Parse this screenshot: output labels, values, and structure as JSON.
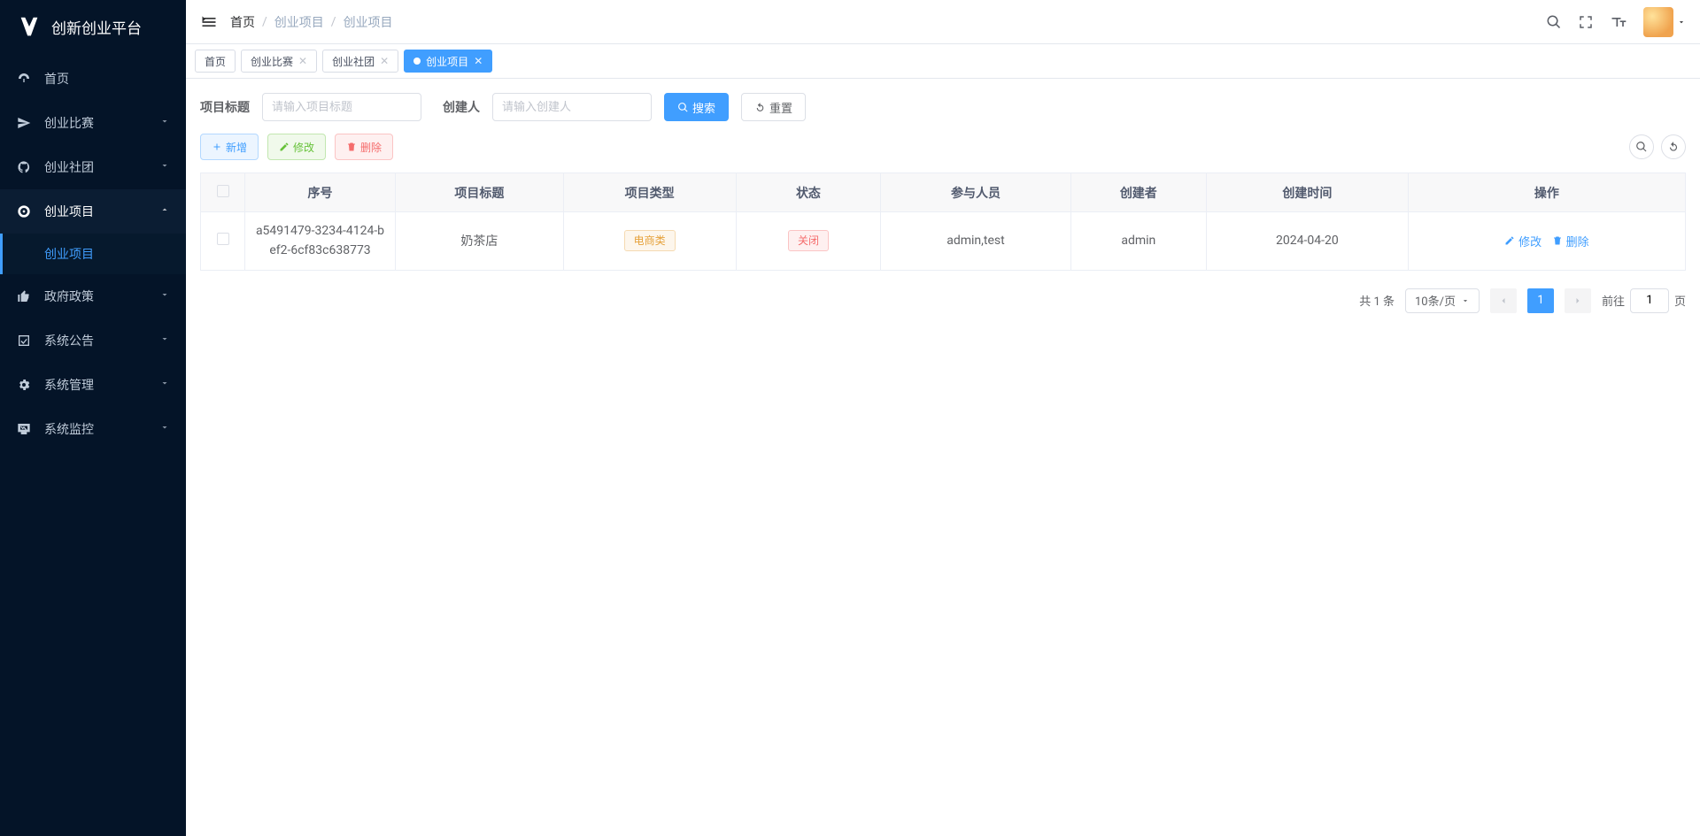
{
  "brand": "创新创业平台",
  "sidebar": {
    "items": [
      {
        "label": "首页",
        "has_children": false
      },
      {
        "label": "创业比赛",
        "has_children": true
      },
      {
        "label": "创业社团",
        "has_children": true
      },
      {
        "label": "创业项目",
        "has_children": true,
        "open": true,
        "children": [
          {
            "label": "创业项目",
            "active": true
          }
        ]
      },
      {
        "label": "政府政策",
        "has_children": true
      },
      {
        "label": "系统公告",
        "has_children": true
      },
      {
        "label": "系统管理",
        "has_children": true
      },
      {
        "label": "系统监控",
        "has_children": true
      }
    ]
  },
  "breadcrumb": [
    "首页",
    "创业项目",
    "创业项目"
  ],
  "tabs": [
    {
      "label": "首页",
      "closable": false,
      "active": false
    },
    {
      "label": "创业比赛",
      "closable": true,
      "active": false
    },
    {
      "label": "创业社团",
      "closable": true,
      "active": false
    },
    {
      "label": "创业项目",
      "closable": true,
      "active": true
    }
  ],
  "filters": {
    "title_label": "项目标题",
    "title_placeholder": "请输入项目标题",
    "creator_label": "创建人",
    "creator_placeholder": "请输入创建人"
  },
  "buttons": {
    "search": "搜索",
    "reset": "重置",
    "add": "新增",
    "edit": "修改",
    "delete": "删除"
  },
  "table": {
    "cols": [
      "序号",
      "项目标题",
      "项目类型",
      "状态",
      "参与人员",
      "创建者",
      "创建时间",
      "操作"
    ],
    "rows": [
      {
        "seq": "a5491479-3234-4124-bef2-6cf83c638773",
        "title": "奶茶店",
        "type": "电商类",
        "status": "关闭",
        "participants": "admin,test",
        "creator": "admin",
        "created_at": "2024-04-20"
      }
    ]
  },
  "row_actions": {
    "edit": "修改",
    "delete": "删除"
  },
  "pagination": {
    "total_label_prefix": "共 ",
    "total": 1,
    "total_label_suffix": " 条",
    "page_size_label": "10条/页",
    "current": 1,
    "jump_prefix": "前往",
    "jump_value": 1,
    "jump_suffix": "页"
  }
}
